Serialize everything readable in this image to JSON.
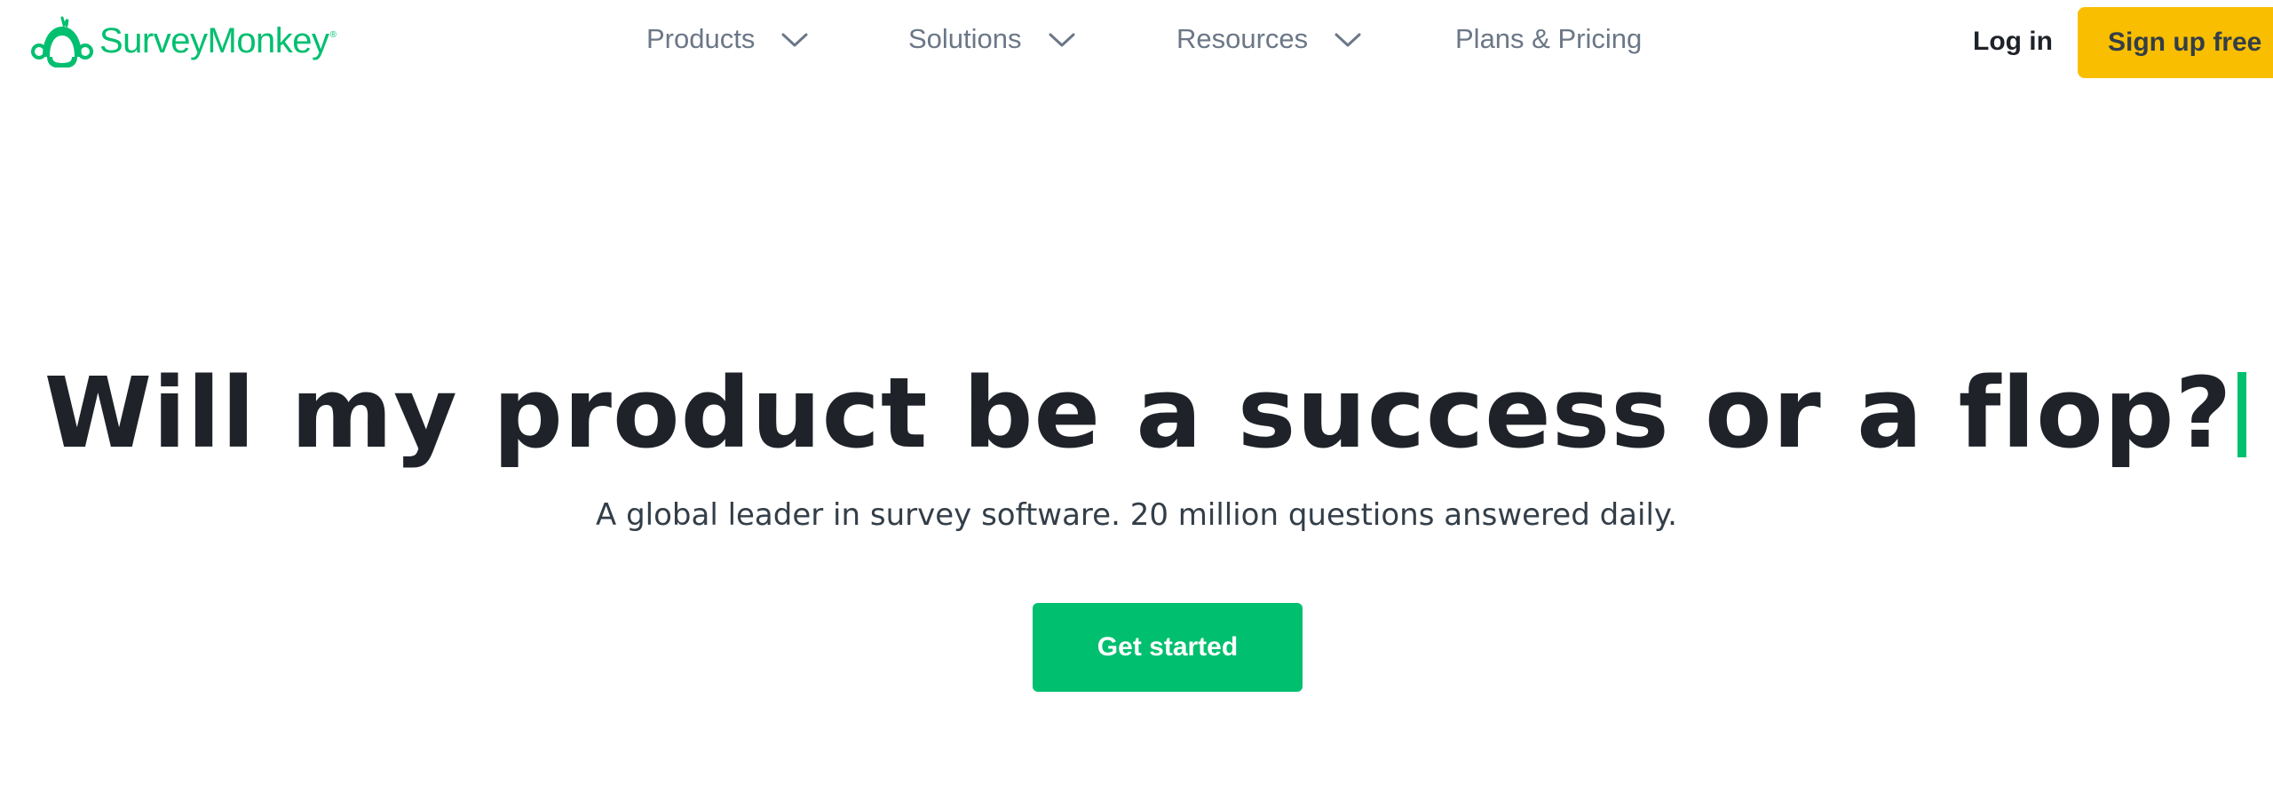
{
  "header": {
    "logo": {
      "text": "SurveyMonkey",
      "registered": "®",
      "icon": "surveymonkey-logo-icon",
      "color": "#00bf6f"
    },
    "nav": [
      {
        "label": "Products",
        "has_dropdown": true,
        "icon": "chevron-down-icon"
      },
      {
        "label": "Solutions",
        "has_dropdown": true,
        "icon": "chevron-down-icon"
      },
      {
        "label": "Resources",
        "has_dropdown": true,
        "icon": "chevron-down-icon"
      },
      {
        "label": "Plans & Pricing",
        "has_dropdown": false
      }
    ],
    "login_label": "Log in",
    "signup_label": "Sign up free"
  },
  "hero": {
    "title": "Will my product be a success or a flop?",
    "subtitle": "A global leader in survey software. 20 million questions answered daily.",
    "cta_label": "Get started"
  },
  "colors": {
    "brand_green": "#00bf6f",
    "signup_yellow": "#f9be00",
    "text_dark": "#1f2329",
    "nav_gray": "#6b7787"
  }
}
